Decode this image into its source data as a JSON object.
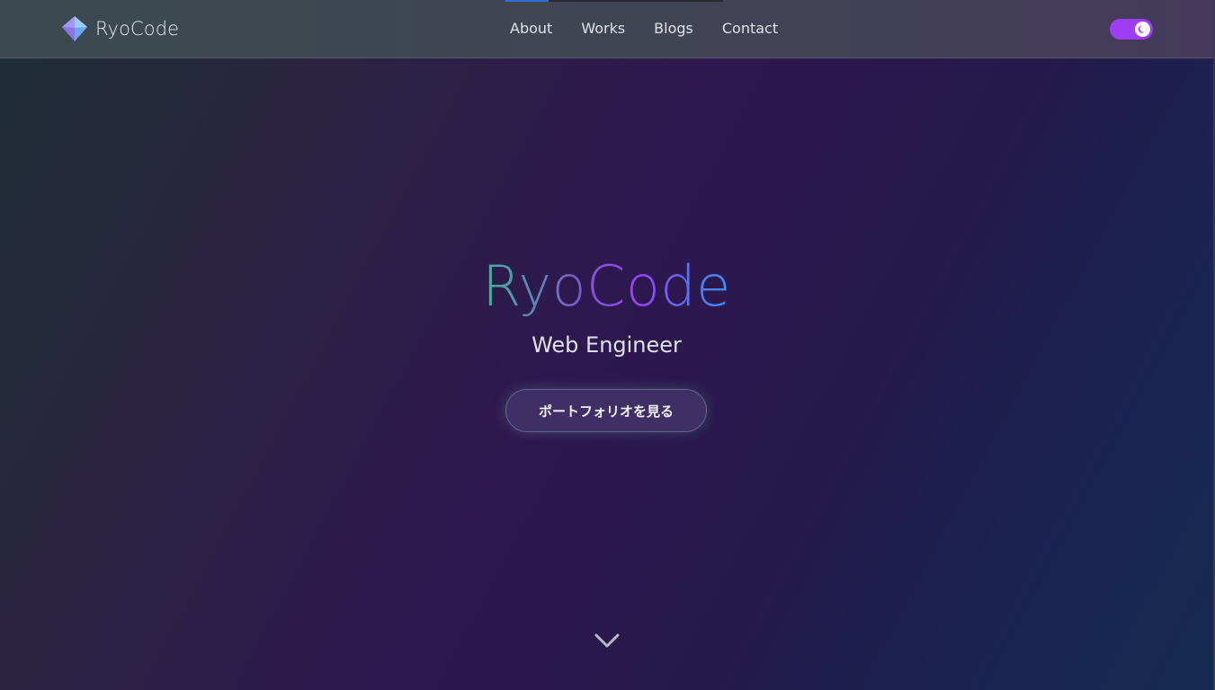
{
  "header": {
    "logo_text": "RyoCode",
    "nav": [
      {
        "label": "About"
      },
      {
        "label": "Works"
      },
      {
        "label": "Blogs"
      },
      {
        "label": "Contact"
      }
    ],
    "scroll_progress_fraction": 0.2,
    "theme_toggle": {
      "mode": "dark",
      "icon": "moon-icon"
    }
  },
  "hero": {
    "title": "RyoCode",
    "subtitle": "Web Engineer",
    "cta_label": "ポートフォリオを見る",
    "scroll_icon": "chevron-down-icon"
  },
  "colors": {
    "accent_toggle": "#9f3cf5",
    "gradient_green": "#3fb59b",
    "gradient_purple": "#9a3ff0",
    "gradient_blue": "#3b8ff0"
  }
}
